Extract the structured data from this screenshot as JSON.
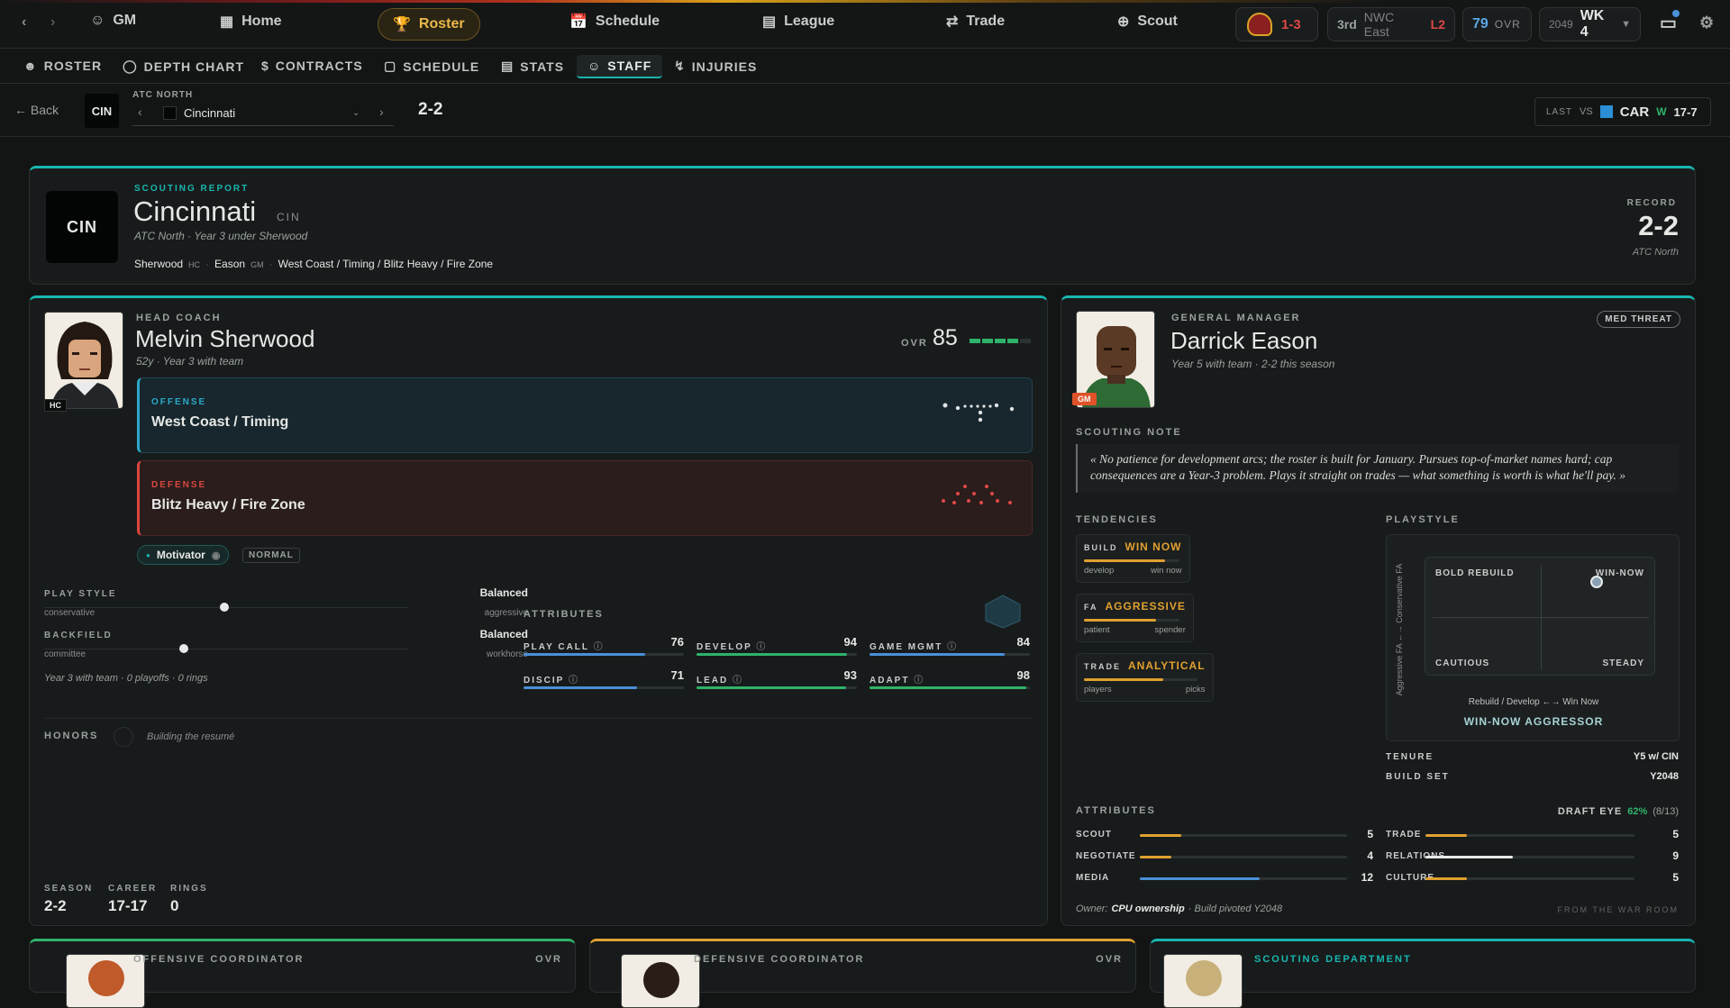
{
  "topnav": {
    "gm": "GM",
    "home": "Home",
    "roster": "Roster",
    "schedule": "Schedule",
    "league": "League",
    "trade": "Trade",
    "scout": "Scout",
    "team_record": "1-3",
    "standing": "3rd",
    "division": "NWC East",
    "streak": "L2",
    "ovr_value": "79",
    "ovr_label": "OVR",
    "year": "2049",
    "week": "WK 4"
  },
  "subnav": {
    "roster": "ROSTER",
    "depth": "DEPTH CHART",
    "contracts": "CONTRACTS",
    "schedule": "SCHEDULE",
    "stats": "STATS",
    "staff": "STAFF",
    "injuries": "INJURIES"
  },
  "teambar": {
    "back": "← Back",
    "abbr": "CIN",
    "conference": "ATC NORTH",
    "team": "Cincinnati",
    "record": "2-2",
    "last_label": "LAST",
    "vs": "VS",
    "opp": "CAR",
    "result": "W",
    "score": "17-7"
  },
  "report": {
    "label": "SCOUTING REPORT",
    "name": "Cincinnati",
    "abbr": "CIN",
    "sub": "ATC North · Year 3 under Sherwood",
    "hc": "Sherwood",
    "hc_tag": "HC",
    "gm": "Eason",
    "gm_tag": "GM",
    "schemes": "West Coast / Timing / Blitz Heavy / Fire Zone",
    "record_label": "RECORD",
    "record": "2-2",
    "record_div": "ATC North"
  },
  "coach": {
    "role": "HEAD COACH",
    "name": "Melvin Sherwood",
    "sub": "52y · Year 3 with team",
    "badge": "HC",
    "ovr_label": "OVR",
    "ovr": "85",
    "offense_label": "OFFENSE",
    "offense": "West Coast / Timing",
    "defense_label": "DEFENSE",
    "defense": "Blitz Heavy / Fire Zone",
    "trait": "Motivator",
    "trait_level": "NORMAL",
    "playstyle_label": "PLAY STYLE",
    "playstyle_value": "Balanced",
    "playstyle_left": "conservative",
    "playstyle_right": "aggressive",
    "playstyle_level": 0.5,
    "backfield_label": "BACKFIELD",
    "backfield_value": "Balanced",
    "backfield_left": "committee",
    "backfield_right": "workhorse",
    "backfield_level": 0.5,
    "history": "Year 3 with team · 0 playoffs · 0 rings",
    "attrs_label": "ATTRIBUTES",
    "attrs": [
      {
        "k": "PLAY CALL",
        "v": "76",
        "c": "#4a90d9"
      },
      {
        "k": "DEVELOP",
        "v": "94",
        "c": "#2fb36a"
      },
      {
        "k": "GAME MGMT",
        "v": "84",
        "c": "#4a90d9"
      },
      {
        "k": "DISCIP",
        "v": "71",
        "c": "#4a90d9"
      },
      {
        "k": "LEAD",
        "v": "93",
        "c": "#2fb36a"
      },
      {
        "k": "ADAPT",
        "v": "98",
        "c": "#2fb36a"
      }
    ],
    "honors_label": "HONORS",
    "honors": "Building the resumé",
    "season_label": "SEASON",
    "season": "2-2",
    "career_label": "CAREER",
    "career": "17-17",
    "rings_label": "RINGS",
    "rings": "0"
  },
  "gm": {
    "role": "GENERAL MANAGER",
    "name": "Darrick Eason",
    "sub": "Year 5 with team · 2-2 this season",
    "badge": "GM",
    "threat": "MED THREAT",
    "note_label": "SCOUTING NOTE",
    "note": "« No patience for development arcs; the roster is built for January. Pursues top-of-market names hard; cap consequences are a Year-3 problem. Plays it straight on trades — what something is worth is what he'll pay. »",
    "tend_label": "TENDENCIES",
    "tend": [
      {
        "k": "BUILD",
        "v": "WIN NOW",
        "l": "develop",
        "r": "win now",
        "lvl": 0.85
      },
      {
        "k": "FA",
        "v": "AGGRESSIVE",
        "l": "patient",
        "r": "spender",
        "lvl": 0.75
      },
      {
        "k": "TRADE",
        "v": "ANALYTICAL",
        "l": "players",
        "r": "picks",
        "lvl": 0.7
      }
    ],
    "ps_label": "PLAYSTYLE",
    "ps_yaxis": "Aggressive FA ←→ Conservative FA",
    "q_tl": "BOLD REBUILD",
    "q_tr": "WIN-NOW",
    "q_bl": "CAUTIOUS",
    "q_br": "STEADY",
    "ps_xaxis": "Rebuild / Develop ←→ Win Now",
    "ps_result": "WIN-NOW AGGRESSOR",
    "tenure_label": "TENURE",
    "tenure": "Y5 w/ CIN",
    "buildset_label": "BUILD SET",
    "buildset": "Y2048",
    "attrs_label": "ATTRIBUTES",
    "drafteye_label": "DRAFT EYE",
    "drafteye": "62%",
    "drafteye_sub": "(8/13)",
    "attrs": [
      {
        "k": "SCOUT",
        "v": "5",
        "lvl": 0.2,
        "c": "#e0a030"
      },
      {
        "k": "TRADE",
        "v": "5",
        "lvl": 0.2,
        "c": "#e0a030"
      },
      {
        "k": "NEGOTIATE",
        "v": "4",
        "lvl": 0.15,
        "c": "#e0a030"
      },
      {
        "k": "RELATIONS",
        "v": "9",
        "lvl": 0.42,
        "c": "#e8eaea"
      },
      {
        "k": "MEDIA",
        "v": "12",
        "lvl": 0.58,
        "c": "#4a90d9"
      },
      {
        "k": "CULTURE",
        "v": "5",
        "lvl": 0.2,
        "c": "#e0a030"
      }
    ],
    "owner_label": "Owner:",
    "owner": "CPU ownership",
    "owner_sub": "· Build pivoted Y2048",
    "footer": "FROM THE WAR ROOM"
  },
  "bottom": {
    "oc": "OFFENSIVE COORDINATOR",
    "oc_ovr": "OVR",
    "dc": "DEFENSIVE COORDINATOR",
    "dc_ovr": "OVR",
    "scouting": "SCOUTING DEPARTMENT"
  }
}
